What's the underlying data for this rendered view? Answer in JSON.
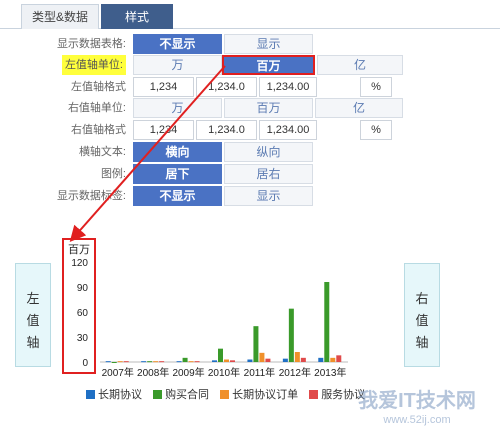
{
  "tabs": [
    {
      "label": "类型&数据"
    },
    {
      "label": "样式"
    }
  ],
  "settings": {
    "show_table": {
      "label": "显示数据表格:",
      "options": [
        "不显示",
        "显示"
      ],
      "selected": 0
    },
    "left_unit": {
      "label": "左值轴单位:",
      "options": [
        "万",
        "百万",
        "亿"
      ],
      "selected": 1
    },
    "left_format": {
      "label": "左值轴格式",
      "values": [
        "1,234",
        "1,234.0",
        "1,234.00"
      ],
      "pct": "%"
    },
    "right_unit": {
      "label": "右值轴单位:",
      "options": [
        "万",
        "百万",
        "亿"
      ]
    },
    "right_format": {
      "label": "右值轴格式",
      "values": [
        "1,234",
        "1,234.0",
        "1,234.00"
      ],
      "pct": "%"
    },
    "x_text": {
      "label": "横轴文本:",
      "options": [
        "横向",
        "纵向"
      ],
      "selected": 0
    },
    "legend": {
      "label": "图例:",
      "options": [
        "居下",
        "居右"
      ],
      "selected": 0
    },
    "show_labels": {
      "label": "显示数据标签:",
      "options": [
        "不显示",
        "显示"
      ],
      "selected": 0
    }
  },
  "left_axis_box": {
    "chars": [
      "左",
      "值",
      "轴"
    ]
  },
  "right_axis_box": {
    "chars": [
      "右",
      "值",
      "轴"
    ]
  },
  "chart_data": {
    "type": "bar",
    "ylabel": "百万",
    "ylim": [
      0,
      120
    ],
    "yticks": [
      0,
      30,
      60,
      90,
      120
    ],
    "categories": [
      "2007年",
      "2008年",
      "2009年",
      "2010年",
      "2011年",
      "2012年",
      "2013年"
    ],
    "series": [
      {
        "name": "长期协议",
        "color": "#1f6fc4",
        "values": [
          1,
          1,
          1,
          2,
          3,
          4,
          5
        ]
      },
      {
        "name": "购买合同",
        "color": "#3a9a2a",
        "values": [
          0,
          1,
          5,
          16,
          43,
          64,
          96
        ]
      },
      {
        "name": "长期协议订单",
        "color": "#f0902a",
        "values": [
          1,
          1,
          1,
          3,
          11,
          12,
          5
        ]
      },
      {
        "name": "服务协议",
        "color": "#e04a4a",
        "values": [
          1,
          1,
          1,
          2,
          4,
          5,
          8
        ]
      }
    ]
  },
  "watermark": {
    "text": "我爱IT技术网",
    "url": "www.52ij.com"
  }
}
